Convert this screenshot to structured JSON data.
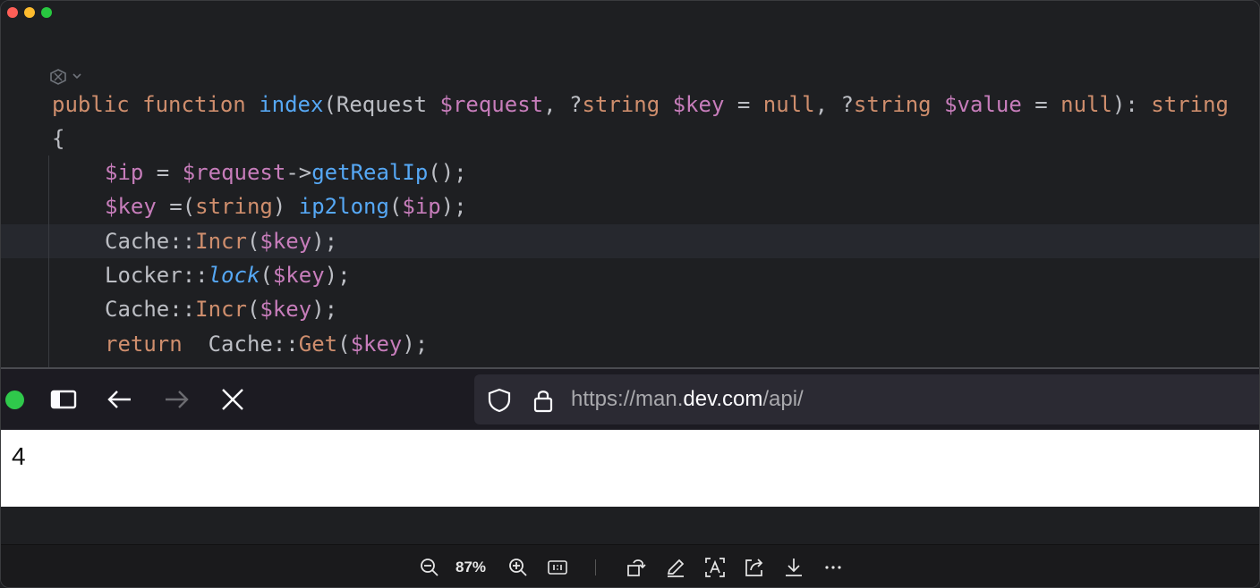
{
  "code": {
    "lines": [
      [
        {
          "t": "public",
          "c": "kw"
        },
        {
          "t": " "
        },
        {
          "t": "function",
          "c": "kw"
        },
        {
          "t": " "
        },
        {
          "t": "index",
          "c": "fn"
        },
        {
          "t": "(Request "
        },
        {
          "t": "$request",
          "c": "var"
        },
        {
          "t": ", ?"
        },
        {
          "t": "string",
          "c": "kw"
        },
        {
          "t": " "
        },
        {
          "t": "$key",
          "c": "var"
        },
        {
          "t": " = "
        },
        {
          "t": "null",
          "c": "kw"
        },
        {
          "t": ", ?"
        },
        {
          "t": "string",
          "c": "kw"
        },
        {
          "t": " "
        },
        {
          "t": "$value",
          "c": "var"
        },
        {
          "t": " = "
        },
        {
          "t": "null",
          "c": "kw"
        },
        {
          "t": "): "
        },
        {
          "t": "string",
          "c": "kw"
        }
      ],
      [
        {
          "t": "{"
        }
      ],
      [
        {
          "t": "$ip",
          "c": "var"
        },
        {
          "t": " = "
        },
        {
          "t": "$request",
          "c": "var"
        },
        {
          "t": "->"
        },
        {
          "t": "getRealIp",
          "c": "fn"
        },
        {
          "t": "();"
        }
      ],
      [
        {
          "t": "$key",
          "c": "var"
        },
        {
          "t": " =("
        },
        {
          "t": "string",
          "c": "kw"
        },
        {
          "t": ") "
        },
        {
          "t": "ip2long",
          "c": "fn"
        },
        {
          "t": "("
        },
        {
          "t": "$ip",
          "c": "var"
        },
        {
          "t": ");"
        }
      ],
      [
        {
          "t": "Cache::"
        },
        {
          "t": "Incr",
          "c": "kw"
        },
        {
          "t": "("
        },
        {
          "t": "$key",
          "c": "var"
        },
        {
          "t": ");"
        }
      ],
      [
        {
          "t": "Locker::"
        },
        {
          "t": "lock",
          "c": "fn it"
        },
        {
          "t": "("
        },
        {
          "t": "$key",
          "c": "var"
        },
        {
          "t": ");"
        }
      ],
      [
        {
          "t": "Cache::"
        },
        {
          "t": "Incr",
          "c": "kw"
        },
        {
          "t": "("
        },
        {
          "t": "$key",
          "c": "var"
        },
        {
          "t": ");"
        }
      ],
      [
        {
          "t": "return",
          "c": "kw"
        },
        {
          "t": "  Cache::"
        },
        {
          "t": "Get",
          "c": "kw"
        },
        {
          "t": "("
        },
        {
          "t": "$key",
          "c": "var"
        },
        {
          "t": ");"
        }
      ]
    ]
  },
  "browser": {
    "url_scheme": "https://",
    "url_subdomain": "man.",
    "url_host": "dev.com",
    "url_path": "/api/"
  },
  "page": {
    "value": "4"
  },
  "viewer": {
    "zoom": "87%"
  },
  "colors": {
    "keyword": "#cf8e6d",
    "function": "#56a8f5",
    "variable": "#c77dbb",
    "text": "#bcbec4"
  }
}
